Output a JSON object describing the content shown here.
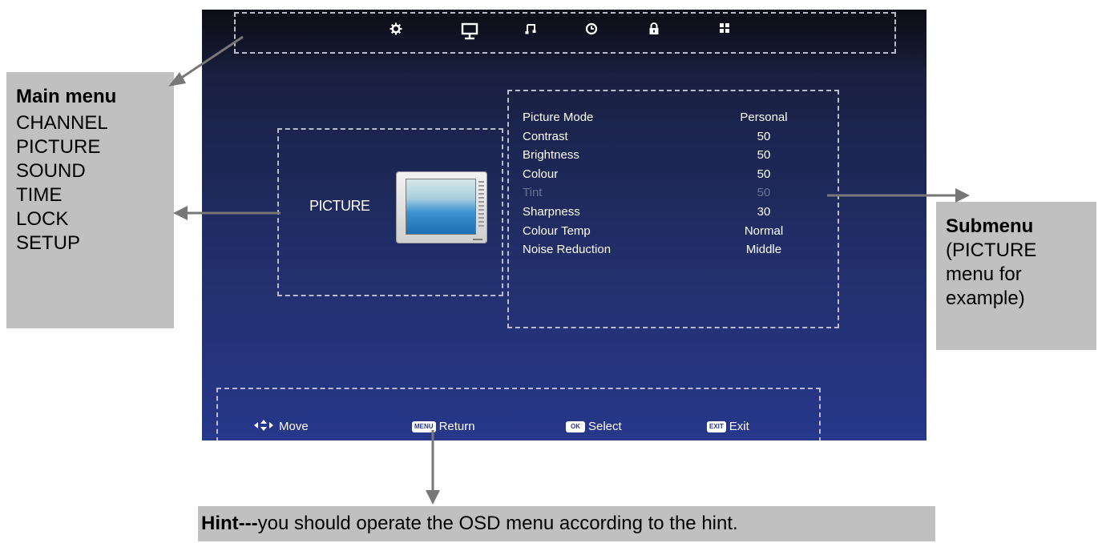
{
  "menu_icons": [
    "gear-icon",
    "monitor-icon",
    "music-note-icon",
    "clock-icon",
    "lock-icon",
    "grid-icon"
  ],
  "main_panel": {
    "label": "PICTURE"
  },
  "submenu": [
    {
      "label": "Picture Mode",
      "value": "Personal",
      "enabled": true
    },
    {
      "label": "Contrast",
      "value": "50",
      "enabled": true
    },
    {
      "label": "Brightness",
      "value": "50",
      "enabled": true
    },
    {
      "label": "Colour",
      "value": "50",
      "enabled": true
    },
    {
      "label": "Tint",
      "value": "50",
      "enabled": false
    },
    {
      "label": "Sharpness",
      "value": "30",
      "enabled": true
    },
    {
      "label": "Colour Temp",
      "value": "Normal",
      "enabled": true
    },
    {
      "label": "Noise Reduction",
      "value": "Middle",
      "enabled": true
    }
  ],
  "hints": [
    {
      "key": "",
      "label": "Move"
    },
    {
      "key": "MENU",
      "label": "Return"
    },
    {
      "key": "OK",
      "label": "Select"
    },
    {
      "key": "EXIT",
      "label": "Exit"
    }
  ],
  "annotations": {
    "main_menu": {
      "title": "Main menu",
      "items": [
        "CHANNEL",
        "PICTURE",
        "SOUND",
        "TIME",
        "LOCK",
        "SETUP"
      ]
    },
    "submenu": {
      "title": "Submenu",
      "lines": [
        "(PICTURE",
        "menu for",
        "example)"
      ]
    },
    "hint": {
      "bold": "Hint---",
      "text": "you should operate the OSD menu according to the hint."
    }
  },
  "colors": {
    "screen_bottom": "#27378a",
    "annotation_bg": "#c0c0c0",
    "arrow": "#777777"
  }
}
